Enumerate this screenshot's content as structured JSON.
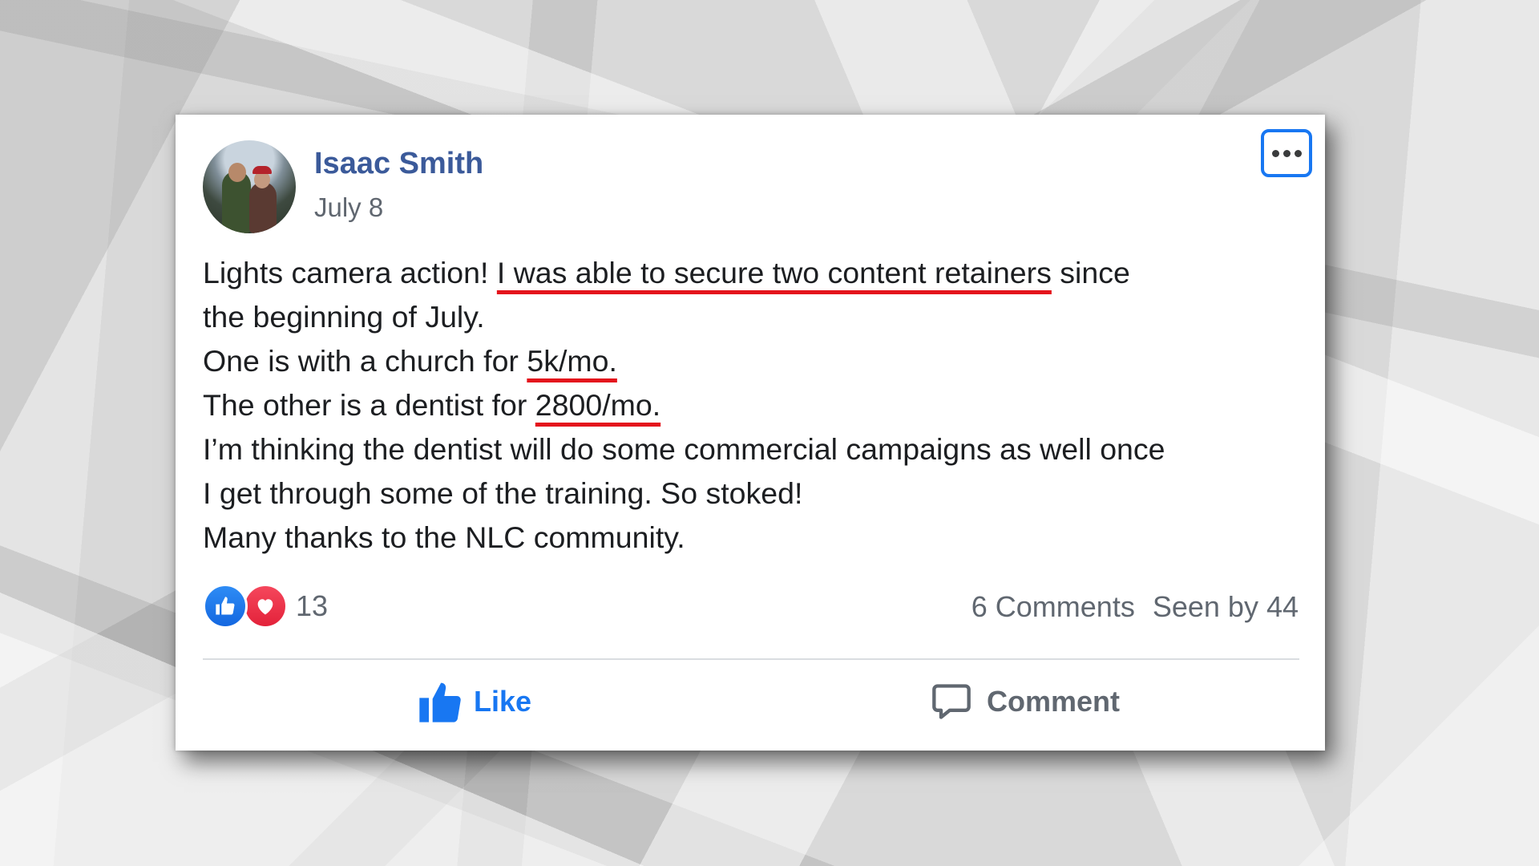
{
  "post": {
    "author": "Isaac Smith",
    "date": "July 8",
    "lines": [
      {
        "pre": "Lights camera action! ",
        "highlight": "I was able to secure two content retainers",
        "post": " since"
      },
      {
        "pre": "the beginning of July.",
        "highlight": "",
        "post": ""
      },
      {
        "pre": "One is with a church for ",
        "highlight": "5k/mo.",
        "post": ""
      },
      {
        "pre": "The other is a dentist for ",
        "highlight": "2800/mo.",
        "post": ""
      },
      {
        "pre": "I’m thinking the dentist will do some commercial campaigns as well once",
        "highlight": "",
        "post": ""
      },
      {
        "pre": "I get through some of the training. So stoked!",
        "highlight": "",
        "post": ""
      },
      {
        "pre": "Many thanks to the NLC community.",
        "highlight": "",
        "post": ""
      }
    ]
  },
  "reactions": {
    "count": "13",
    "icons": [
      "thumbs-up-icon",
      "heart-icon"
    ]
  },
  "stats": {
    "comments": "6 Comments",
    "seen": "Seen by 44"
  },
  "actions": {
    "like_label": "Like",
    "comment_label": "Comment"
  },
  "colors": {
    "author": "#3b5a9a",
    "accent": "#1877f2",
    "underline": "#e4141c",
    "love": "#e3223a"
  }
}
